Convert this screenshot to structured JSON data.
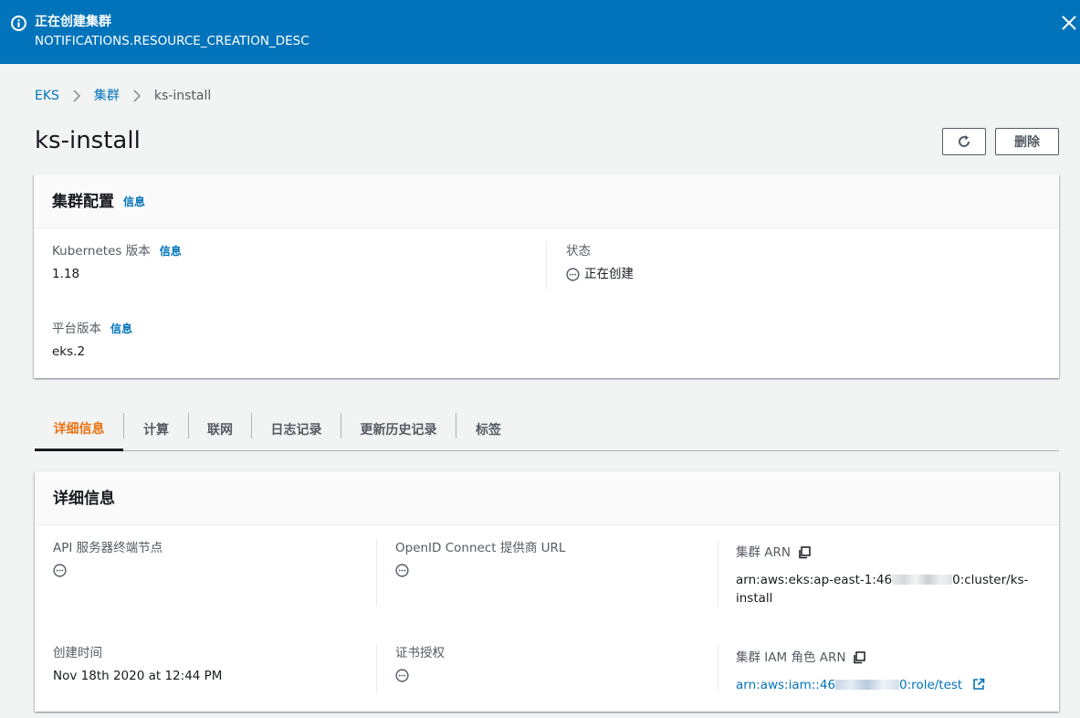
{
  "banner": {
    "title": "正在创建集群",
    "description": "NOTIFICATIONS.RESOURCE_CREATION_DESC"
  },
  "breadcrumb": {
    "root": "EKS",
    "section": "集群",
    "current": "ks-install"
  },
  "page": {
    "title": "ks-install",
    "delete_label": "删除"
  },
  "cluster_config": {
    "title": "集群配置",
    "info_label": "信息",
    "k8s_version_label": "Kubernetes 版本",
    "k8s_version_info": "信息",
    "k8s_version_value": "1.18",
    "status_label": "状态",
    "status_value": "正在创建",
    "platform_version_label": "平台版本",
    "platform_version_info": "信息",
    "platform_version_value": "eks.2"
  },
  "tabs": [
    {
      "label": "详细信息"
    },
    {
      "label": "计算"
    },
    {
      "label": "联网"
    },
    {
      "label": "日志记录"
    },
    {
      "label": "更新历史记录"
    },
    {
      "label": "标签"
    }
  ],
  "details": {
    "title": "详细信息",
    "api_endpoint_label": "API 服务器终端节点",
    "oidc_label": "OpenID Connect 提供商 URL",
    "cluster_arn_label": "集群 ARN",
    "cluster_arn_line1": "arn:aws:eks:ap-east-1:46",
    "cluster_arn_line1_end": "0:cluster/ks-",
    "cluster_arn_line2": "install",
    "created_label": "创建时间",
    "created_value": "Nov 18th 2020 at 12:44 PM",
    "cert_label": "证书授权",
    "iam_role_label": "集群 IAM 角色 ARN",
    "iam_role_prefix": "arn:aws:iam::46",
    "iam_role_suffix": "0:role/test"
  },
  "colors": {
    "banner_bg": "#0073bb",
    "link": "#0073bb",
    "active_tab": "#ec7211"
  }
}
